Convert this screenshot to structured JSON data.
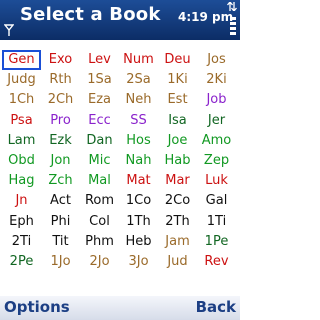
{
  "header": {
    "title": "Select a Book",
    "time": "4:19 pm"
  },
  "softkeys": {
    "left": "Options",
    "right": "Back"
  },
  "colors": {
    "red": "#cc1111",
    "brown": "#9a6a2a",
    "purple": "#8a22cc",
    "green": "#119922",
    "dark_green": "#116622",
    "black": "#111111",
    "selected_outline": "#1a4fd6"
  },
  "selected_book": "Gen",
  "books": [
    {
      "label": "Gen",
      "color": "#cc1111"
    },
    {
      "label": "Exo",
      "color": "#cc1111"
    },
    {
      "label": "Lev",
      "color": "#cc1111"
    },
    {
      "label": "Num",
      "color": "#cc1111"
    },
    {
      "label": "Deu",
      "color": "#cc1111"
    },
    {
      "label": "Jos",
      "color": "#9a6a2a"
    },
    {
      "label": "Judg",
      "color": "#9a6a2a"
    },
    {
      "label": "Rth",
      "color": "#9a6a2a"
    },
    {
      "label": "1Sa",
      "color": "#9a6a2a"
    },
    {
      "label": "2Sa",
      "color": "#9a6a2a"
    },
    {
      "label": "1Ki",
      "color": "#9a6a2a"
    },
    {
      "label": "2Ki",
      "color": "#9a6a2a"
    },
    {
      "label": "1Ch",
      "color": "#9a6a2a"
    },
    {
      "label": "2Ch",
      "color": "#9a6a2a"
    },
    {
      "label": "Eza",
      "color": "#9a6a2a"
    },
    {
      "label": "Neh",
      "color": "#9a6a2a"
    },
    {
      "label": "Est",
      "color": "#9a6a2a"
    },
    {
      "label": "Job",
      "color": "#8a22cc"
    },
    {
      "label": "Psa",
      "color": "#cc1111"
    },
    {
      "label": "Pro",
      "color": "#8a22cc"
    },
    {
      "label": "Ecc",
      "color": "#8a22cc"
    },
    {
      "label": "SS",
      "color": "#8a22cc"
    },
    {
      "label": "Isa",
      "color": "#116622"
    },
    {
      "label": "Jer",
      "color": "#116622"
    },
    {
      "label": "Lam",
      "color": "#116622"
    },
    {
      "label": "Ezk",
      "color": "#116622"
    },
    {
      "label": "Dan",
      "color": "#116622"
    },
    {
      "label": "Hos",
      "color": "#119922"
    },
    {
      "label": "Joe",
      "color": "#119922"
    },
    {
      "label": "Amo",
      "color": "#119922"
    },
    {
      "label": "Obd",
      "color": "#119922"
    },
    {
      "label": "Jon",
      "color": "#119922"
    },
    {
      "label": "Mic",
      "color": "#119922"
    },
    {
      "label": "Nah",
      "color": "#119922"
    },
    {
      "label": "Hab",
      "color": "#119922"
    },
    {
      "label": "Zep",
      "color": "#119922"
    },
    {
      "label": "Hag",
      "color": "#119922"
    },
    {
      "label": "Zch",
      "color": "#119922"
    },
    {
      "label": "Mal",
      "color": "#119922"
    },
    {
      "label": "Mat",
      "color": "#cc1111"
    },
    {
      "label": "Mar",
      "color": "#cc1111"
    },
    {
      "label": "Luk",
      "color": "#cc1111"
    },
    {
      "label": "Jn",
      "color": "#cc1111"
    },
    {
      "label": "Act",
      "color": "#111111"
    },
    {
      "label": "Rom",
      "color": "#111111"
    },
    {
      "label": "1Co",
      "color": "#111111"
    },
    {
      "label": "2Co",
      "color": "#111111"
    },
    {
      "label": "Gal",
      "color": "#111111"
    },
    {
      "label": "Eph",
      "color": "#111111"
    },
    {
      "label": "Phi",
      "color": "#111111"
    },
    {
      "label": "Col",
      "color": "#111111"
    },
    {
      "label": "1Th",
      "color": "#111111"
    },
    {
      "label": "2Th",
      "color": "#111111"
    },
    {
      "label": "1Ti",
      "color": "#111111"
    },
    {
      "label": "2Ti",
      "color": "#111111"
    },
    {
      "label": "Tit",
      "color": "#111111"
    },
    {
      "label": "Phm",
      "color": "#111111"
    },
    {
      "label": "Heb",
      "color": "#111111"
    },
    {
      "label": "Jam",
      "color": "#9a6a2a"
    },
    {
      "label": "1Pe",
      "color": "#116622"
    },
    {
      "label": "2Pe",
      "color": "#116622"
    },
    {
      "label": "1Jo",
      "color": "#9a6a2a"
    },
    {
      "label": "2Jo",
      "color": "#9a6a2a"
    },
    {
      "label": "3Jo",
      "color": "#9a6a2a"
    },
    {
      "label": "Jud",
      "color": "#9a6a2a"
    },
    {
      "label": "Rev",
      "color": "#cc1111"
    }
  ]
}
